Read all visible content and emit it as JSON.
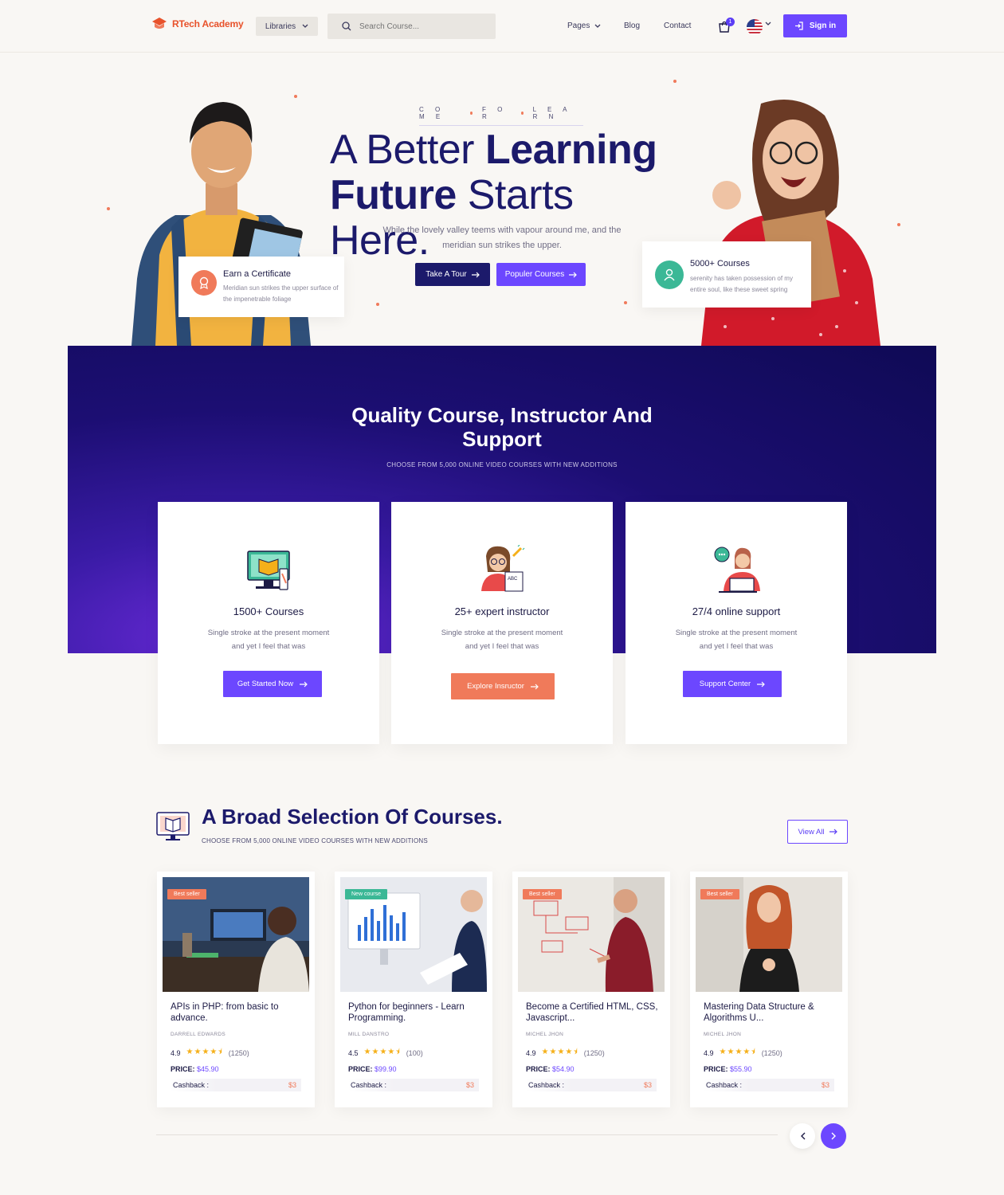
{
  "nav": {
    "brand": "RTech Academy",
    "libraries_label": "Libraries",
    "search_placeholder": "Search Course...",
    "pages_label": "Pages",
    "blog_label": "Blog",
    "contact_label": "Contact",
    "cart_count": "1",
    "signin_label": "Sign in"
  },
  "hero": {
    "kicker": [
      "C O M E",
      "F O R",
      "L E A R N"
    ],
    "title_line1_light": "A Better",
    "title_line1_bold": "Learning",
    "title_line2_bold": "Future",
    "title_line2_light": "Starts Here.",
    "subtitle": "While the lovely valley teems with vapour around me, and the meridian sun strikes the upper.",
    "tour_button": "Take A Tour",
    "popular_button": "Populer Courses",
    "cert_card": {
      "title": "Earn a Certificate",
      "text": "Meridian sun strikes the upper surface of the impenetrable foliage"
    },
    "courses_card": {
      "title": "5000+ Courses",
      "text": "serenity has taken possession of my entire soul, like these sweet spring"
    }
  },
  "quality": {
    "title": "Quality Course, Instructor And Support",
    "subtitle": "CHOOSE FROM 5,000 ONLINE VIDEO COURSES WITH NEW ADDITIONS",
    "features": [
      {
        "title": "1500+ Courses",
        "text": "Single stroke at the present moment and yet I feel that was",
        "button": "Get Started Now",
        "button_color": "#6c47ff"
      },
      {
        "title": "25+ expert instructor",
        "text": "Single stroke at the present moment and yet I feel that was",
        "button": "Explore Insructor",
        "button_color": "#f07a5a"
      },
      {
        "title": "27/4 online support",
        "text": "Single stroke at the present moment and yet I feel that was",
        "button": "Support Center",
        "button_color": "#6c47ff"
      }
    ]
  },
  "selection": {
    "title": "A Broad Selection Of Courses.",
    "subtitle": "CHOOSE FROM 5,000 ONLINE VIDEO COURSES WITH NEW ADDITIONS",
    "view_all": "View All",
    "courses": [
      {
        "tag": "Best seller",
        "tag_color": "#f07a5a",
        "title": "APIs in PHP: from basic to advance.",
        "author": "DARRELL EDWARDS",
        "rating": "4.9",
        "stars": "★★★★⯨",
        "count": "(1250)",
        "price_label": "PRICE:",
        "price": "$45.90",
        "cashback_label": "Cashback :",
        "cashback": "$3"
      },
      {
        "tag": "New course",
        "tag_color": "#3bb896",
        "title": "Python for beginners - Learn Programming.",
        "author": "MILL DANSTRO",
        "rating": "4.5",
        "stars": "★★★★⯨",
        "count": "(100)",
        "price_label": "PRICE:",
        "price": "$99.90",
        "cashback_label": "Cashback :",
        "cashback": "$3"
      },
      {
        "tag": "Best seller",
        "tag_color": "#f07a5a",
        "title": "Become a Certified HTML, CSS, Javascript...",
        "author": "MICHEL JHON",
        "rating": "4.9",
        "stars": "★★★★⯨",
        "count": "(1250)",
        "price_label": "PRICE:",
        "price": "$54.90",
        "cashback_label": "Cashback :",
        "cashback": "$3"
      },
      {
        "tag": "Best seller",
        "tag_color": "#f07a5a",
        "title": "Mastering Data Structure & Algorithms U...",
        "author": "MICHEL JHON",
        "rating": "4.9",
        "stars": "★★★★⯨",
        "count": "(1250)",
        "price_label": "PRICE:",
        "price": "$55.90",
        "cashback_label": "Cashback :",
        "cashback": "$3"
      }
    ]
  }
}
